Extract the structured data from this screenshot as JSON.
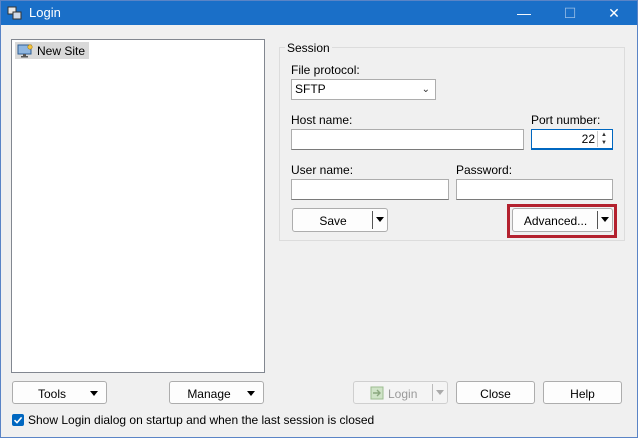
{
  "window": {
    "title": "Login"
  },
  "sites": [
    {
      "label": "New Site"
    }
  ],
  "session": {
    "group_label": "Session",
    "file_protocol_label": "File protocol:",
    "file_protocol_value": "SFTP",
    "host_label": "Host name:",
    "host_value": "",
    "port_label": "Port number:",
    "port_value": "22",
    "user_label": "User name:",
    "user_value": "",
    "password_label": "Password:",
    "password_value": "",
    "save_label": "Save",
    "advanced_label": "Advanced..."
  },
  "bottom": {
    "tools_label": "Tools",
    "manage_label": "Manage",
    "login_label": "Login",
    "close_label": "Close",
    "help_label": "Help",
    "show_login_label": "Show Login dialog on startup and when the last session is closed",
    "show_login_checked": true
  },
  "colors": {
    "titlebar": "#1a6fc8",
    "highlight": "#b3212e",
    "accent": "#0067c0"
  }
}
